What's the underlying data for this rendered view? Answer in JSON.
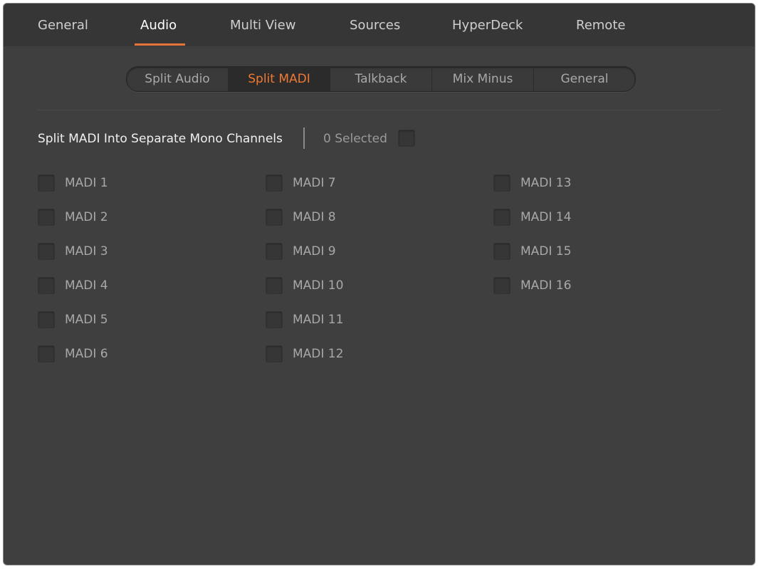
{
  "top_tabs": [
    {
      "label": "General",
      "active": false
    },
    {
      "label": "Audio",
      "active": true
    },
    {
      "label": "Multi View",
      "active": false
    },
    {
      "label": "Sources",
      "active": false
    },
    {
      "label": "HyperDeck",
      "active": false
    },
    {
      "label": "Remote",
      "active": false
    }
  ],
  "sub_tabs": [
    {
      "label": "Split Audio",
      "active": false
    },
    {
      "label": "Split MADI",
      "active": true
    },
    {
      "label": "Talkback",
      "active": false
    },
    {
      "label": "Mix Minus",
      "active": false
    },
    {
      "label": "General",
      "active": false
    }
  ],
  "section": {
    "heading": "Split MADI Into Separate Mono Channels",
    "selected_count": "0 Selected"
  },
  "channels": [
    {
      "label": "MADI 1",
      "checked": false
    },
    {
      "label": "MADI 2",
      "checked": false
    },
    {
      "label": "MADI 3",
      "checked": false
    },
    {
      "label": "MADI 4",
      "checked": false
    },
    {
      "label": "MADI 5",
      "checked": false
    },
    {
      "label": "MADI 6",
      "checked": false
    },
    {
      "label": "MADI 7",
      "checked": false
    },
    {
      "label": "MADI 8",
      "checked": false
    },
    {
      "label": "MADI 9",
      "checked": false
    },
    {
      "label": "MADI 10",
      "checked": false
    },
    {
      "label": "MADI 11",
      "checked": false
    },
    {
      "label": "MADI 12",
      "checked": false
    },
    {
      "label": "MADI 13",
      "checked": false
    },
    {
      "label": "MADI 14",
      "checked": false
    },
    {
      "label": "MADI 15",
      "checked": false
    },
    {
      "label": "MADI 16",
      "checked": false
    }
  ],
  "colors": {
    "accent": "#e8743b",
    "background": "#3f3f3f",
    "header": "#363636"
  }
}
